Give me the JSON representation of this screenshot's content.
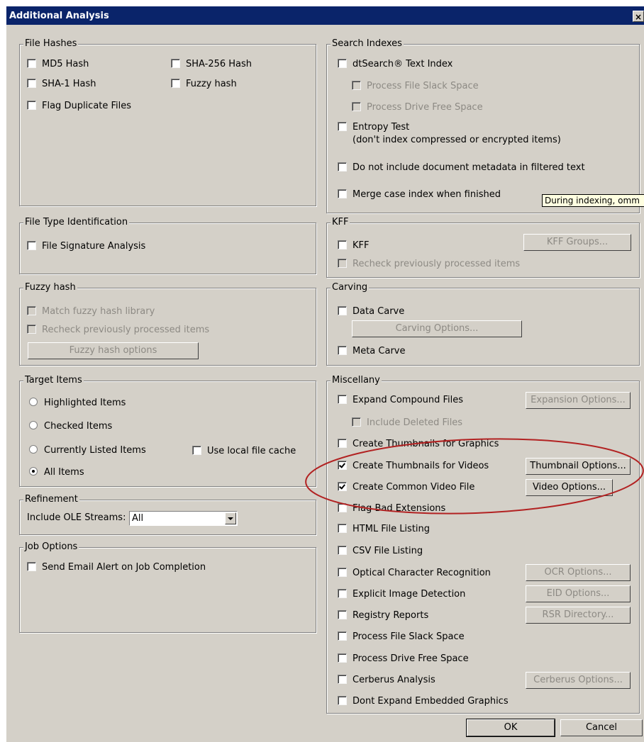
{
  "window": {
    "title": "Additional Analysis",
    "close": "×"
  },
  "file_hashes": {
    "legend": "File Hashes",
    "md5": {
      "label": "MD5 Hash",
      "checked": false
    },
    "sha256": {
      "label": "SHA-256 Hash",
      "checked": false
    },
    "sha1": {
      "label": "SHA-1 Hash",
      "checked": false
    },
    "fuzzy": {
      "label": "Fuzzy hash",
      "checked": false
    },
    "flag_duplicates": {
      "label": "Flag Duplicate Files",
      "checked": false
    }
  },
  "file_type": {
    "legend": "File Type Identification",
    "signature": {
      "label": "File Signature Analysis",
      "checked": false
    }
  },
  "fuzzy_hash": {
    "legend": "Fuzzy hash",
    "match_library": {
      "label": "Match fuzzy hash library",
      "checked": false,
      "disabled": true
    },
    "recheck": {
      "label": "Recheck previously processed items",
      "checked": false,
      "disabled": true
    },
    "options_button": "Fuzzy hash options"
  },
  "target_items": {
    "legend": "Target Items",
    "highlighted": "Highlighted Items",
    "checked_items": "Checked Items",
    "currently_listed": "Currently Listed Items",
    "all_items": "All Items",
    "selected": "All Items",
    "local_cache": {
      "label": "Use local file cache",
      "checked": false
    }
  },
  "refinement": {
    "legend": "Refinement",
    "ole_label": "Include OLE Streams:",
    "ole_value": "All"
  },
  "job_options": {
    "legend": "Job Options",
    "email_alert": {
      "label": "Send Email Alert on Job Completion",
      "checked": false
    }
  },
  "search_indexes": {
    "legend": "Search Indexes",
    "dtsearch": {
      "label": "dtSearch® Text Index",
      "checked": false
    },
    "slack": {
      "label": "Process File Slack Space",
      "checked": false,
      "disabled": true
    },
    "free_space": {
      "label": "Process Drive Free Space",
      "checked": false,
      "disabled": true
    },
    "entropy": {
      "label": "Entropy Test",
      "sublabel": "(don't index compressed or encrypted items)",
      "checked": false
    },
    "no_metadata": {
      "label": "Do not include document metadata in filtered text",
      "checked": false
    },
    "merge_case": {
      "label": "Merge case index when finished",
      "checked": false
    },
    "tooltip": "During indexing, omm"
  },
  "kff": {
    "legend": "KFF",
    "kff": {
      "label": "KFF",
      "checked": false
    },
    "recheck": {
      "label": "Recheck previously processed items",
      "checked": false,
      "disabled": true
    },
    "groups_button": "KFF Groups..."
  },
  "carving": {
    "legend": "Carving",
    "data_carve": {
      "label": "Data Carve",
      "checked": false
    },
    "options_button": "Carving Options...",
    "meta_carve": {
      "label": "Meta Carve",
      "checked": false
    }
  },
  "misc": {
    "legend": "Miscellany",
    "expand_compound": {
      "label": "Expand Compound Files",
      "checked": false
    },
    "expansion_button": "Expansion Options...",
    "include_deleted": {
      "label": "Include Deleted Files",
      "checked": false,
      "disabled": true
    },
    "thumbs_graphics": {
      "label": "Create Thumbnails for Graphics",
      "checked": false
    },
    "thumbs_videos": {
      "label": "Create Thumbnails for Videos",
      "checked": true
    },
    "thumbnail_button": "Thumbnail Options...",
    "common_video": {
      "label": "Create Common Video File",
      "checked": true
    },
    "video_button": "Video Options...",
    "bad_extensions": {
      "label": "Flag Bad Extensions",
      "checked": false
    },
    "html_listing": {
      "label": "HTML File Listing",
      "checked": false
    },
    "csv_listing": {
      "label": "CSV File Listing",
      "checked": false
    },
    "ocr": {
      "label": "Optical Character Recognition",
      "checked": false
    },
    "ocr_button": "OCR Options...",
    "eid": {
      "label": "Explicit Image Detection",
      "checked": false
    },
    "eid_button": "EID Options...",
    "registry": {
      "label": "Registry Reports",
      "checked": false
    },
    "rsr_button": "RSR Directory...",
    "slack": {
      "label": "Process File Slack Space",
      "checked": false
    },
    "free_space": {
      "label": "Process Drive Free Space",
      "checked": false
    },
    "cerberus": {
      "label": "Cerberus Analysis",
      "checked": false
    },
    "cerberus_button": "Cerberus Options...",
    "dont_expand": {
      "label": "Dont Expand Embedded Graphics",
      "checked": false
    }
  },
  "footer": {
    "ok": "OK",
    "cancel": "Cancel"
  },
  "annotation": {
    "color": "#b22222"
  }
}
